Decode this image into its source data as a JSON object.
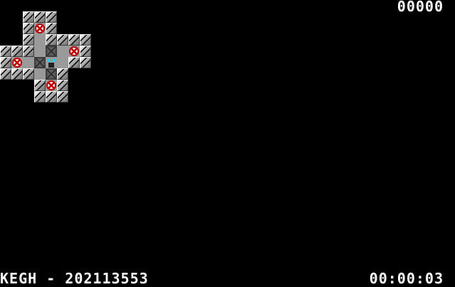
{
  "hud": {
    "score": "00000",
    "level_name": "KEGH - 202113553",
    "timer": "00:00:03"
  },
  "board": {
    "rows": [
      "  ###    ",
      "  #.#    ",
      "  # #### ",
      "### $ .# ",
      "#. $@ ## ",
      "### $#   ",
      "   #.#   ",
      "   ###   "
    ],
    "legend": {
      "#": "wall",
      " ": "floor",
      ".": "goal",
      "$": "crate",
      "@": "player"
    }
  },
  "colors": {
    "background": "#000000",
    "hud_text": "#ffffff",
    "floor": "#9a9a9a",
    "goal": "#c00000",
    "player_eyes": "#00d8ff"
  }
}
